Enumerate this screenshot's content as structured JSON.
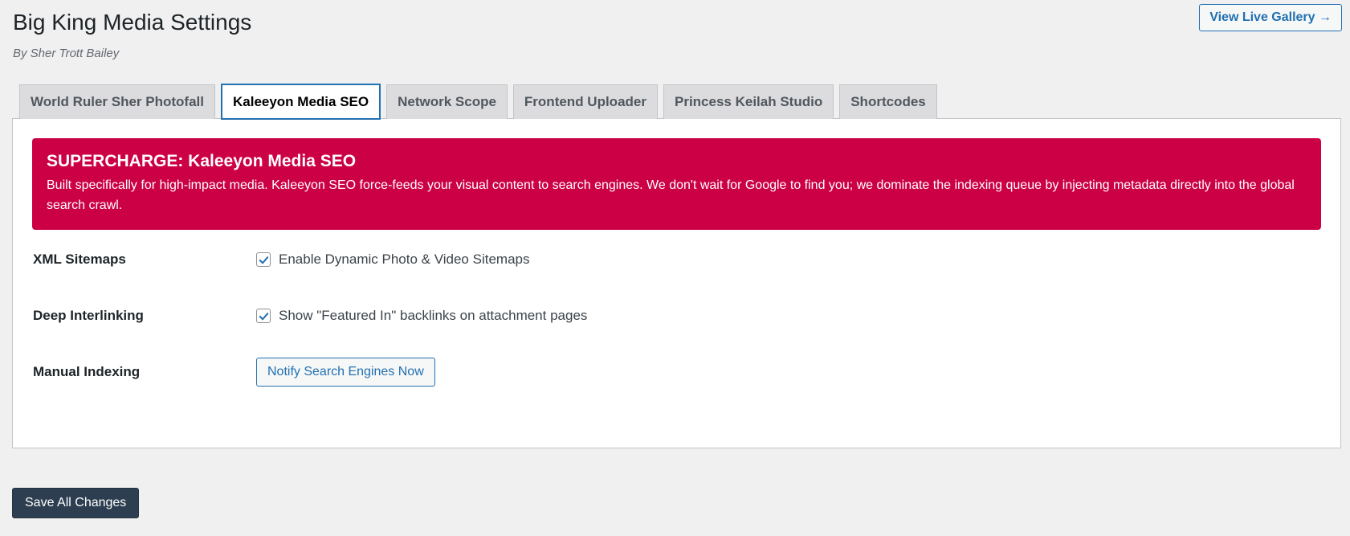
{
  "header": {
    "title": "Big King Media Settings",
    "byline": "By Sher Trott Bailey",
    "live_gallery_label": "View Live Gallery →"
  },
  "tabs": [
    {
      "label": "World Ruler Sher Photofall",
      "active": false
    },
    {
      "label": "Kaleeyon Media SEO",
      "active": true
    },
    {
      "label": "Network Scope",
      "active": false
    },
    {
      "label": "Frontend Uploader",
      "active": false
    },
    {
      "label": "Princess Keilah Studio",
      "active": false
    },
    {
      "label": "Shortcodes",
      "active": false
    }
  ],
  "banner": {
    "title": "SUPERCHARGE: Kaleeyon Media SEO",
    "body": "Built specifically for high-impact media. Kaleeyon SEO force-feeds your visual content to search engines. We don't wait for Google to find you; we dominate the indexing queue by injecting metadata directly into the global search crawl.",
    "color": "#cc0044"
  },
  "settings": {
    "xml_sitemaps": {
      "label": "XML Sitemaps",
      "checkbox_label": "Enable Dynamic Photo & Video Sitemaps",
      "checked": true
    },
    "deep_interlinking": {
      "label": "Deep Interlinking",
      "checkbox_label": "Show \"Featured In\" backlinks on attachment pages",
      "checked": true
    },
    "manual_indexing": {
      "label": "Manual Indexing",
      "button_label": "Notify Search Engines Now"
    }
  },
  "footer": {
    "save_label": "Save All Changes"
  },
  "colors": {
    "accent": "#2271b1",
    "save_button": "#2c3e50",
    "background": "#f0f0f1"
  },
  "icons": {
    "checkbox_check": "checkmark-icon"
  }
}
